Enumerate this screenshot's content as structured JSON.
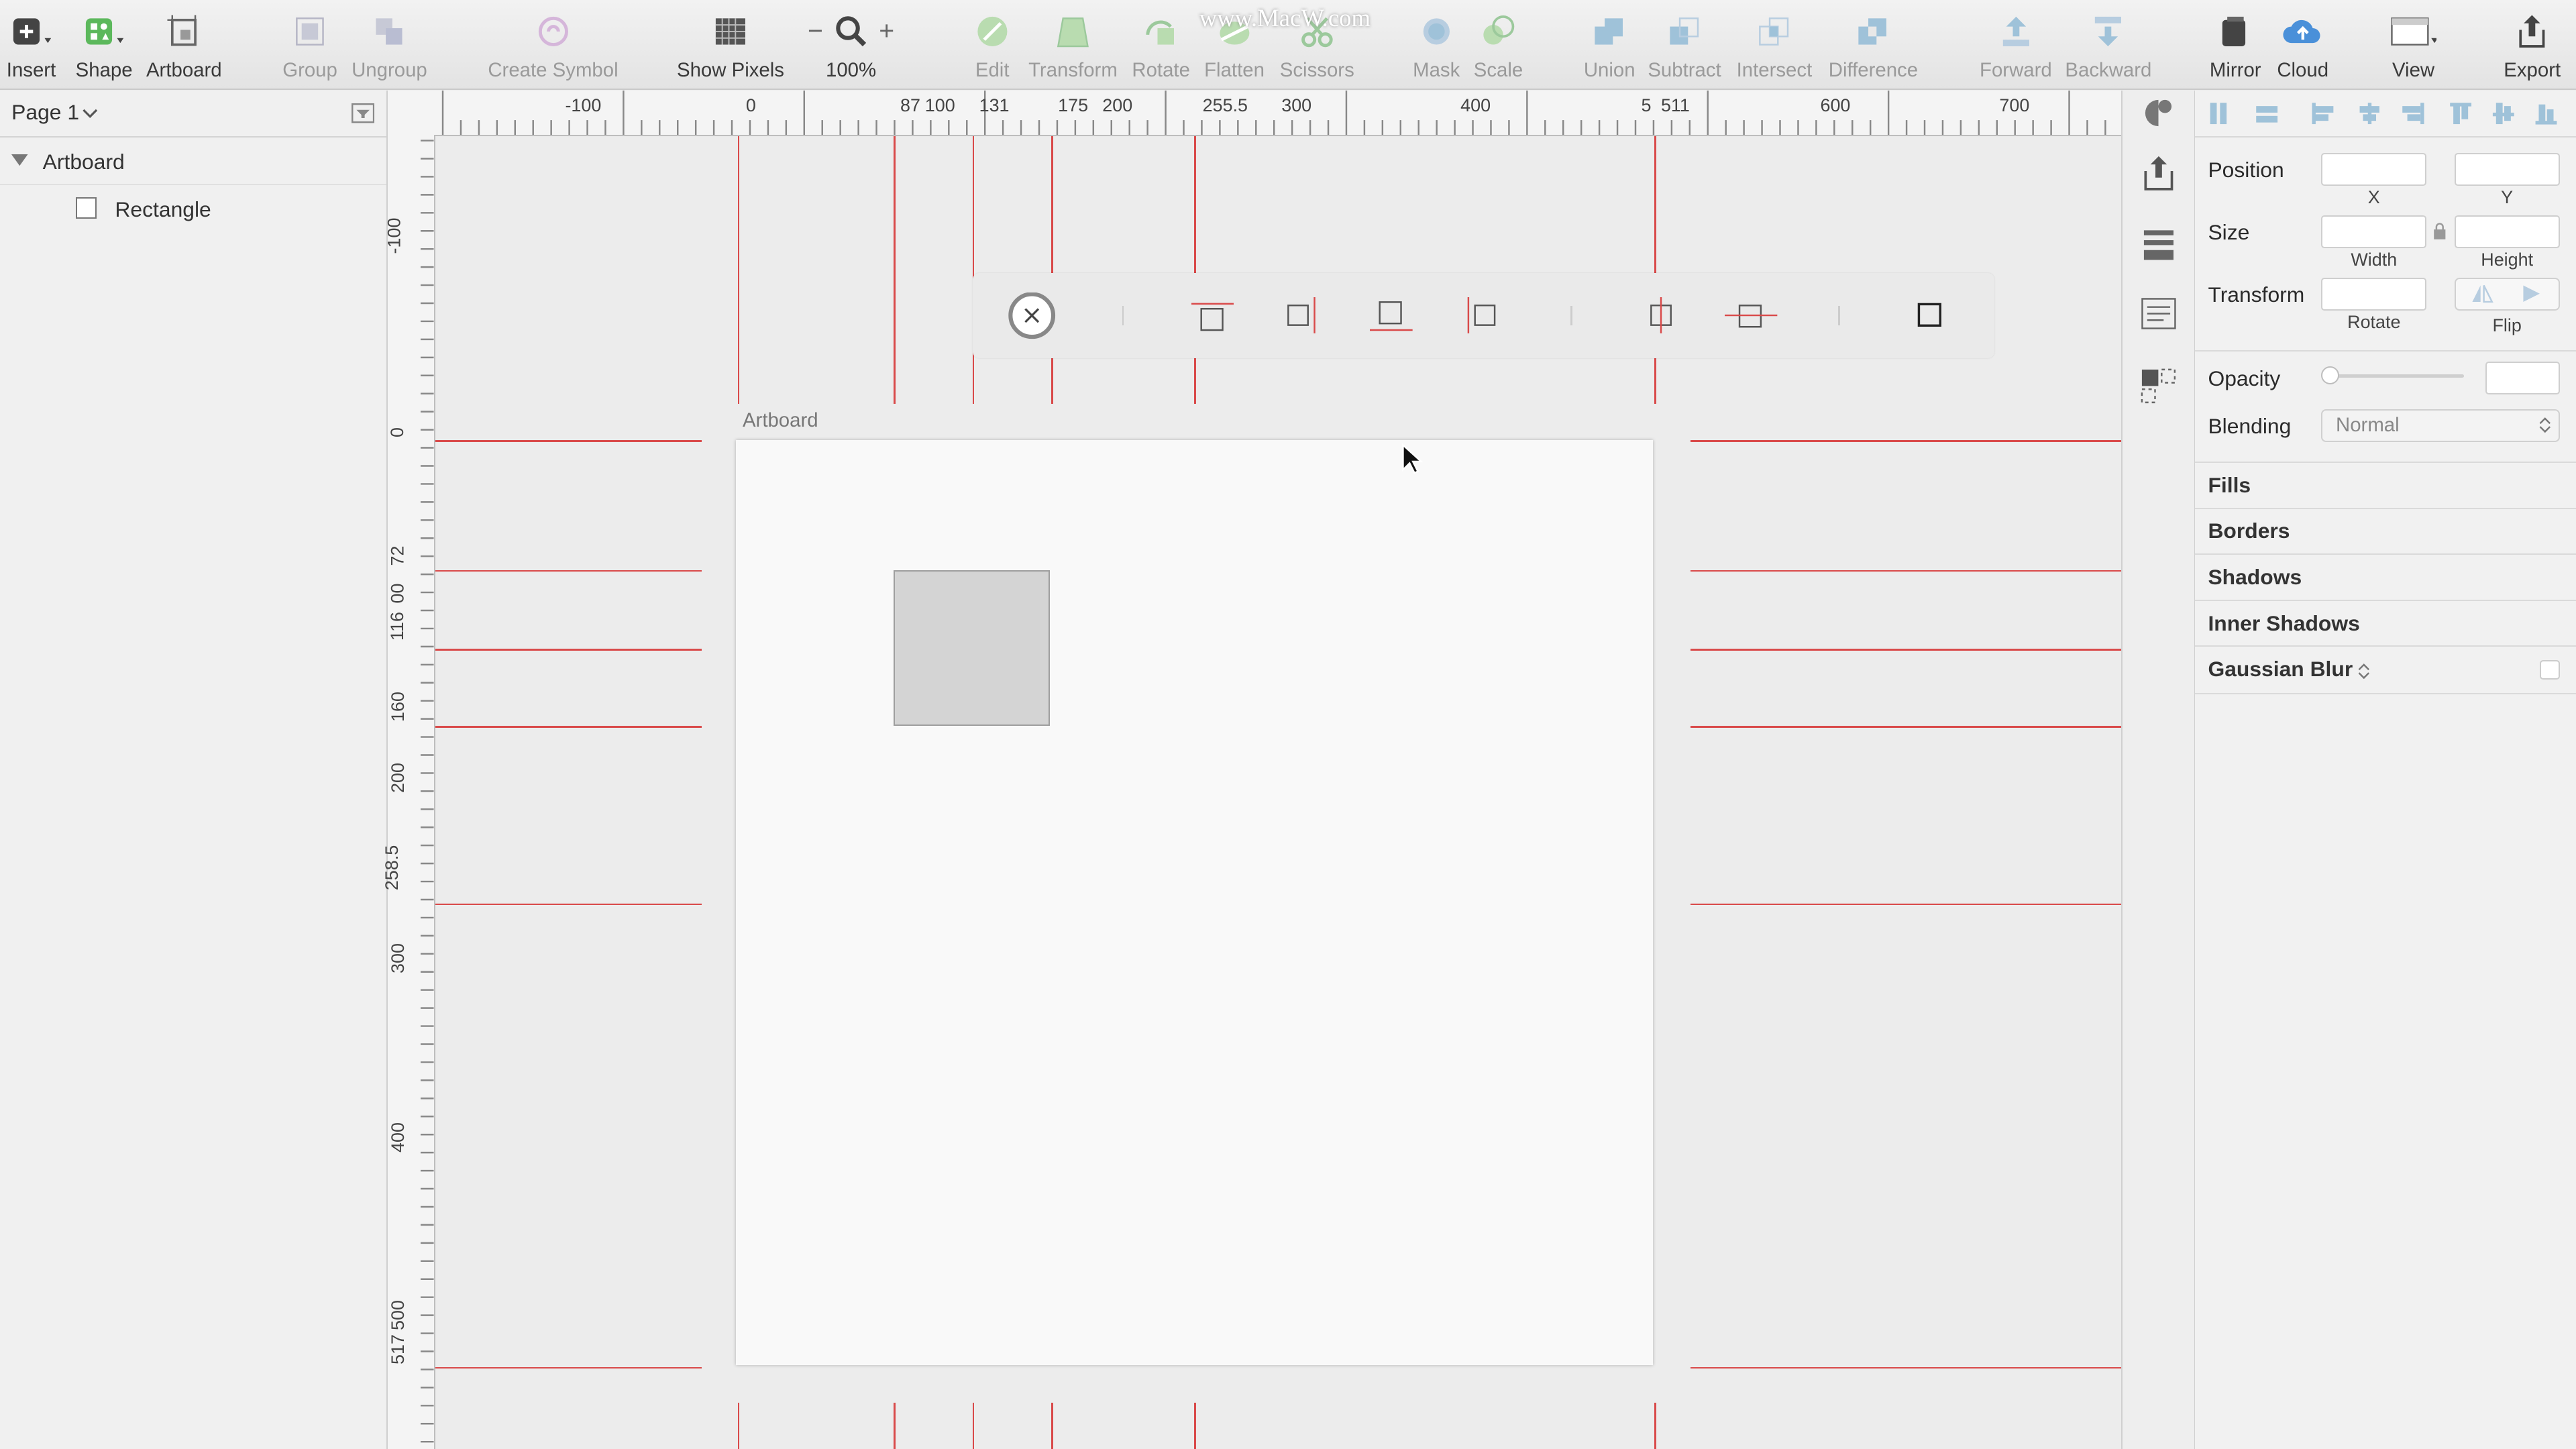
{
  "watermark": "www.MacW.com",
  "toolbar": {
    "items": [
      {
        "label": "Insert"
      },
      {
        "label": "Shape"
      },
      {
        "label": "Artboard"
      },
      {
        "label": "Group"
      },
      {
        "label": "Ungroup"
      },
      {
        "label": "Create Symbol"
      },
      {
        "label": "Show Pixels"
      },
      {
        "label": "100%"
      },
      {
        "label": "Edit"
      },
      {
        "label": "Transform"
      },
      {
        "label": "Rotate"
      },
      {
        "label": "Flatten"
      },
      {
        "label": "Scissors"
      },
      {
        "label": "Mask"
      },
      {
        "label": "Scale"
      },
      {
        "label": "Union"
      },
      {
        "label": "Subtract"
      },
      {
        "label": "Intersect"
      },
      {
        "label": "Difference"
      },
      {
        "label": "Forward"
      },
      {
        "label": "Backward"
      },
      {
        "label": "Mirror"
      },
      {
        "label": "Cloud"
      },
      {
        "label": "View"
      },
      {
        "label": "Export"
      }
    ],
    "zoom_minus": "−",
    "zoom_plus": "+"
  },
  "layers": {
    "page": "Page 1",
    "artboard": "Artboard",
    "rectangle": "Rectangle"
  },
  "canvas": {
    "artboard_label": "Artboard"
  },
  "rulers": {
    "top": [
      "-100",
      "0",
      "87",
      "100",
      "131",
      "175",
      "200",
      "255.5",
      "300",
      "400",
      "5",
      "511",
      "600",
      "700"
    ],
    "left": [
      "-100",
      "0",
      "72",
      "116",
      "00",
      "160",
      "200",
      "258.5",
      "300",
      "400",
      "517",
      "500"
    ]
  },
  "inspector": {
    "position": "Position",
    "x": "X",
    "y": "Y",
    "size": "Size",
    "width": "Width",
    "height": "Height",
    "transform": "Transform",
    "rotate": "Rotate",
    "flip": "Flip",
    "opacity": "Opacity",
    "blending": "Blending",
    "blending_value": "Normal",
    "sections": [
      "Fills",
      "Borders",
      "Shadows",
      "Inner Shadows",
      "Gaussian Blur"
    ]
  }
}
